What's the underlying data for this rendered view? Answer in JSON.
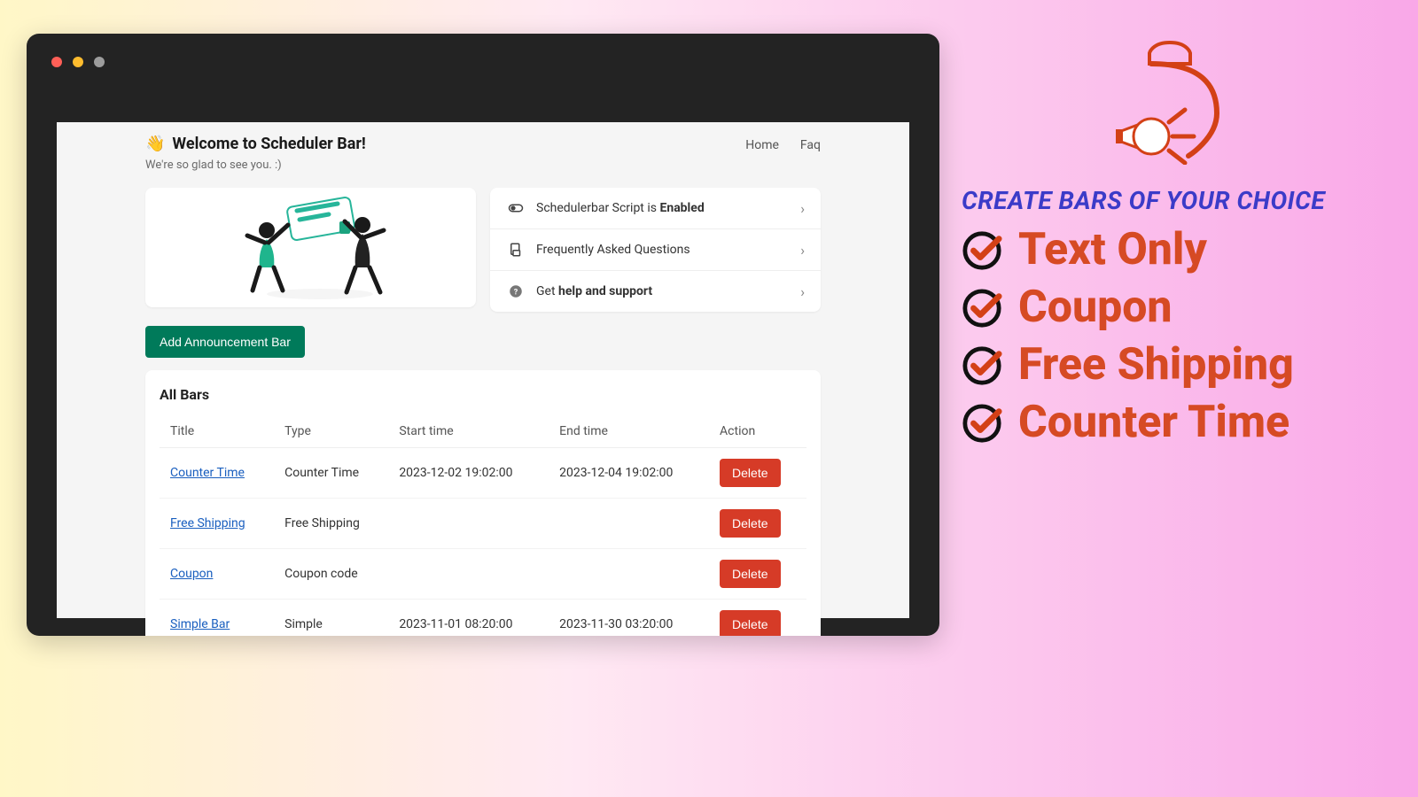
{
  "header": {
    "title": "Welcome to Scheduler Bar!",
    "subtitle": "We're so glad to see you. :)",
    "nav": {
      "home": "Home",
      "faq": "Faq"
    }
  },
  "info_links": {
    "script_prefix": "Schedulerbar Script is ",
    "script_status": "Enabled",
    "faq": "Frequently Asked Questions",
    "help_prefix": "Get ",
    "help_bold": "help and support"
  },
  "buttons": {
    "add": "Add Announcement Bar",
    "delete": "Delete"
  },
  "table": {
    "heading": "All Bars",
    "cols": {
      "title": "Title",
      "type": "Type",
      "start": "Start time",
      "end": "End time",
      "action": "Action"
    },
    "rows": [
      {
        "title": "Counter Time",
        "type": "Counter Time",
        "start": "2023-12-02 19:02:00",
        "end": "2023-12-04 19:02:00"
      },
      {
        "title": "Free Shipping",
        "type": "Free Shipping",
        "start": "",
        "end": ""
      },
      {
        "title": "Coupon",
        "type": "Coupon code",
        "start": "",
        "end": ""
      },
      {
        "title": "Simple Bar",
        "type": "Simple",
        "start": "2023-11-01 08:20:00",
        "end": "2023-11-30 03:20:00"
      }
    ]
  },
  "promo": {
    "heading": "CREATE BARS OF YOUR CHOICE",
    "items": [
      "Text Only",
      "Coupon",
      "Free Shipping",
      "Counter Time"
    ]
  }
}
